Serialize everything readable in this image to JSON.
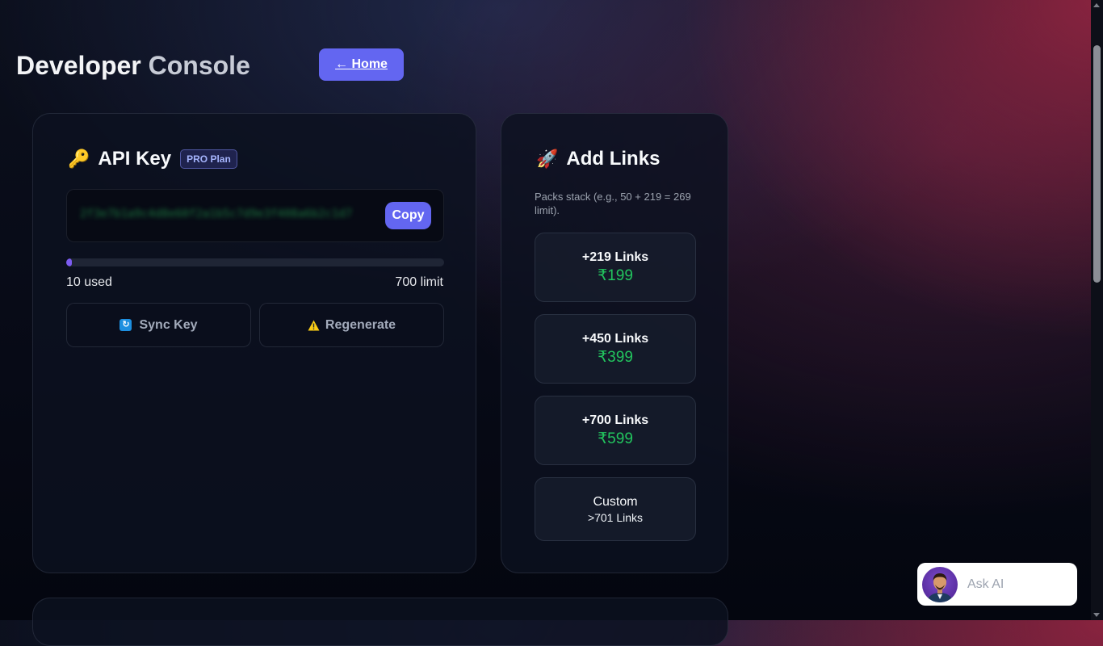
{
  "header": {
    "title_main": "Developer",
    "title_accent": "Console",
    "home_button": "← Home"
  },
  "api_card": {
    "icon": "key-icon",
    "emoji": "🔑",
    "title": "API Key",
    "plan_badge": "PRO Plan",
    "api_key": "2f3e7b1a9c4d8e60f2a1b5c7d9e3f408a6b2c1d7",
    "copy_label": "Copy",
    "used": 10,
    "limit": 700,
    "used_label": "10 used",
    "limit_label": "700 limit",
    "sync_label": "Sync Key",
    "regenerate_label": "Regenerate"
  },
  "links_card": {
    "icon": "rocket-icon",
    "emoji": "🚀",
    "title": "Add Links",
    "description": "Packs stack (e.g., 50 + 219 = 269 limit).",
    "packs": [
      {
        "name": "+219 Links",
        "price": "₹199"
      },
      {
        "name": "+450 Links",
        "price": "₹399"
      },
      {
        "name": "+700 Links",
        "price": "₹599"
      }
    ],
    "custom": {
      "name": "Custom",
      "sub": ">701 Links"
    }
  },
  "ask_ai": {
    "label": "Ask AI"
  },
  "colors": {
    "accent": "#6366f1",
    "price": "#22c55e",
    "progress": "#7c5cf0"
  }
}
